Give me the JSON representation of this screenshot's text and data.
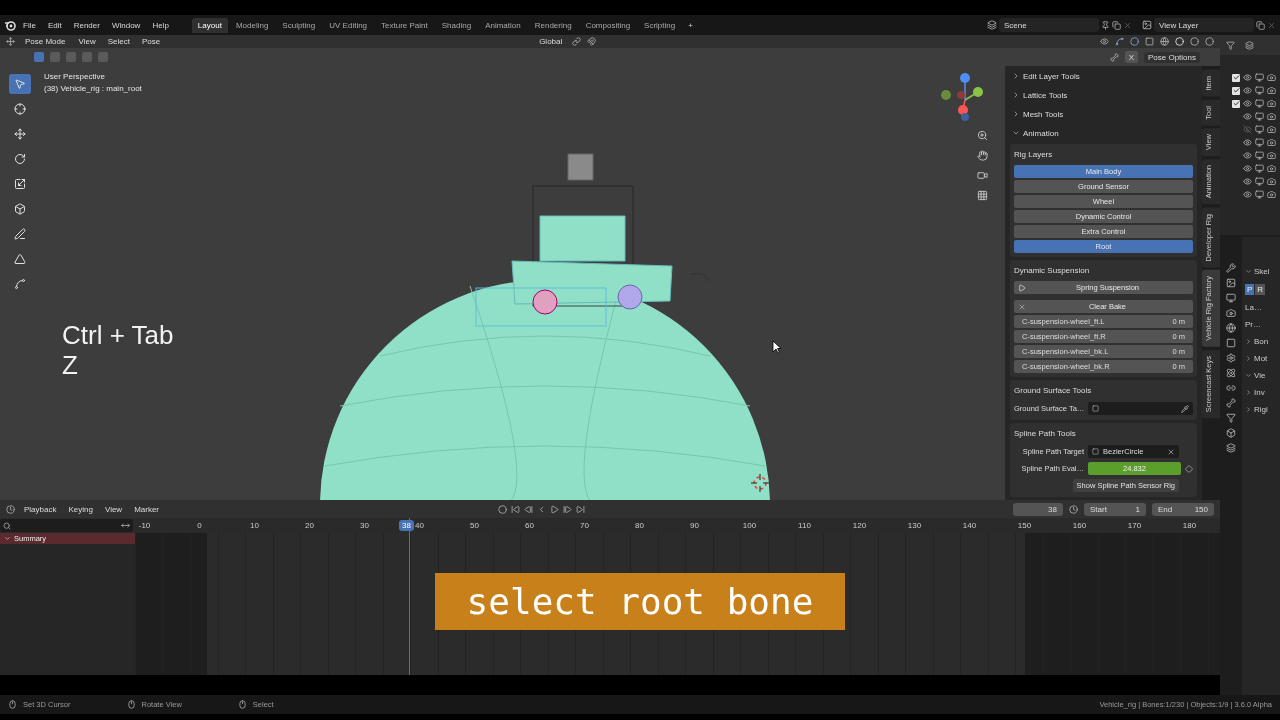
{
  "topbar": {
    "menu": [
      "File",
      "Edit",
      "Render",
      "Window",
      "Help"
    ],
    "workspaces": [
      {
        "label": "Layout",
        "selected": true
      },
      {
        "label": "Modeling",
        "selected": false
      },
      {
        "label": "Sculpting",
        "selected": false
      },
      {
        "label": "UV Editing",
        "selected": false
      },
      {
        "label": "Texture Paint",
        "selected": false
      },
      {
        "label": "Shading",
        "selected": false
      },
      {
        "label": "Animation",
        "selected": false
      },
      {
        "label": "Rendering",
        "selected": false
      },
      {
        "label": "Compositing",
        "selected": false
      },
      {
        "label": "Scripting",
        "selected": false
      }
    ],
    "add_workspace": "+",
    "scene": "Scene",
    "view_layer": "View Layer"
  },
  "viewport_header": {
    "mode": "Pose Mode",
    "menus": [
      "View",
      "Select",
      "Pose"
    ],
    "orientation": "Global",
    "mirror_x": "X",
    "pose_options": "Pose Options"
  },
  "viewport": {
    "perspective": "User Perspective",
    "active": "(38) Vehicle_rig : main_root",
    "keys": [
      "Ctrl + Tab",
      "Z"
    ],
    "tools": [
      {
        "selected": true
      },
      {
        "selected": false
      },
      {
        "selected": false
      },
      {
        "selected": false
      },
      {
        "selected": false
      },
      {
        "selected": false
      },
      {
        "selected": false
      },
      {
        "selected": false
      },
      {
        "selected": false
      }
    ]
  },
  "sidebar": {
    "panels": [
      {
        "label": "Edit Layer Tools",
        "expanded": false
      },
      {
        "label": "Lattice Tools",
        "expanded": false
      },
      {
        "label": "Mesh Tools",
        "expanded": false
      },
      {
        "label": "Animation",
        "expanded": true
      }
    ],
    "rig_layers": {
      "title": "Rig Layers",
      "layers": [
        {
          "label": "Main Body",
          "on": true
        },
        {
          "label": "Ground Sensor",
          "on": false
        },
        {
          "label": "Wheel",
          "on": false
        },
        {
          "label": "Dynamic Control",
          "on": false
        },
        {
          "label": "Extra Control",
          "on": false
        },
        {
          "label": "Root",
          "on": true
        }
      ]
    },
    "dynamic_suspension": {
      "title": "Dynamic Suspension",
      "spring_button": "Spring Suspension",
      "clear_button": "Clear Bake",
      "fields": [
        {
          "label": "C-suspension-wheel_ft.L",
          "value": "0 m"
        },
        {
          "label": "C-suspension-wheel_ft.R",
          "value": "0 m"
        },
        {
          "label": "C-suspension-wheel_bk.L",
          "value": "0 m"
        },
        {
          "label": "C-suspension-wheel_bk.R",
          "value": "0 m"
        }
      ]
    },
    "ground_surface": {
      "title": "Ground Surface Tools",
      "label": "Ground Surface Ta…"
    },
    "spline_path": {
      "title": "Spline Path Tools",
      "target_label": "Spline Path Target",
      "target": "BezierCircle",
      "eval_label": "Spline Path Eval…",
      "eval_value": "24.832",
      "sensor_button": "Show Spline Path Sensor Rig"
    },
    "tabs": [
      {
        "label": "Item",
        "selected": false
      },
      {
        "label": "Tool",
        "selected": false
      },
      {
        "label": "View",
        "selected": false
      },
      {
        "label": "Animation",
        "selected": false
      },
      {
        "label": "Developer Rig",
        "selected": false
      },
      {
        "label": "Vehicle Rig Factory",
        "selected": true
      },
      {
        "label": "Screencast Keys",
        "selected": false
      }
    ]
  },
  "outliner": {
    "rows": [
      {
        "kind": "collection",
        "checked": true
      },
      {
        "kind": "collection",
        "checked": true
      },
      {
        "kind": "collection",
        "checked": true
      },
      {
        "kind": "object",
        "visible": true
      },
      {
        "kind": "object",
        "visible": false
      },
      {
        "kind": "object",
        "visible": true
      },
      {
        "kind": "object",
        "visible": true
      },
      {
        "kind": "object",
        "visible": true
      },
      {
        "kind": "object",
        "visible": true
      },
      {
        "kind": "object",
        "visible": true
      }
    ]
  },
  "properties": {
    "items": [
      {
        "kind": "section",
        "label": "Skel",
        "expanded": true
      },
      {
        "kind": "toggle",
        "buttons": [
          {
            "label": "P",
            "selected": true
          },
          {
            "label": "R",
            "selected": false
          }
        ]
      },
      {
        "kind": "label",
        "label": "La…"
      },
      {
        "kind": "label",
        "label": "Pr…"
      },
      {
        "kind": "section",
        "label": "Bon",
        "expanded": false
      },
      {
        "kind": "section",
        "label": "Mot",
        "expanded": false
      },
      {
        "kind": "section",
        "label": "Vie",
        "expanded": true
      },
      {
        "kind": "section",
        "label": "Inv",
        "expanded": false
      },
      {
        "kind": "section",
        "label": "Rigi",
        "expanded": false
      }
    ]
  },
  "timeline": {
    "menus": [
      "Playback",
      "Keying",
      "View",
      "Marker"
    ],
    "current_frame": "38",
    "start_label": "Start",
    "start": "1",
    "end_label": "End",
    "end": "150",
    "ruler": [
      "-10",
      "0",
      "10",
      "20",
      "30",
      "40",
      "50",
      "60",
      "70",
      "80",
      "90",
      "100",
      "110",
      "120",
      "130",
      "140",
      "150",
      "160",
      "170",
      "180"
    ],
    "playhead": "38",
    "channels": [
      "Summary"
    ],
    "caption": "select root bone"
  },
  "status_bar": {
    "hints": [
      "Set 3D Cursor",
      "Rotate View",
      "Select"
    ],
    "info": "Vehicle_rig | Bones:1/230 | Objects:1/9 | 3.6.0 Alpha"
  }
}
